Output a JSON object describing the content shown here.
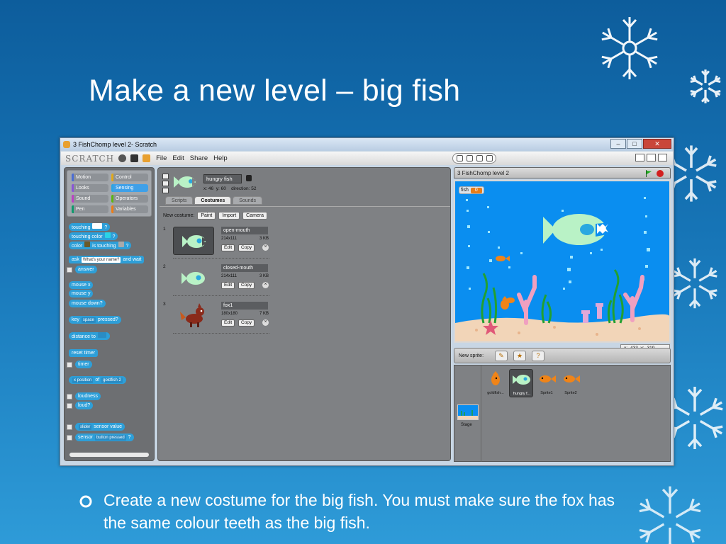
{
  "slide": {
    "title": "Make a new level – big fish",
    "bullet": "Create a new costume for the big fish. You must make sure the fox has the same colour teeth as the big fish."
  },
  "window": {
    "title": "3 FishChomp level 2- Scratch",
    "logo": "SCRATCH",
    "menu": [
      "File",
      "Edit",
      "Share",
      "Help"
    ],
    "controls": [
      "–",
      "□",
      "✕"
    ]
  },
  "palette": {
    "categories": [
      {
        "label": "Motion",
        "color": "#4a6cd4"
      },
      {
        "label": "Control",
        "color": "#e1a91a"
      },
      {
        "label": "Looks",
        "color": "#8a55d7"
      },
      {
        "label": "Sensing",
        "color": "#2ca5e2"
      },
      {
        "label": "Sound",
        "color": "#bb42c3"
      },
      {
        "label": "Operators",
        "color": "#5cb712"
      },
      {
        "label": "Pen",
        "color": "#0e9a6c"
      },
      {
        "label": "Variables",
        "color": "#ee7d16"
      }
    ],
    "selected_category": "Sensing",
    "blocks": {
      "touching": "touching",
      "touching_color": "touching color",
      "color": "color",
      "is_touching": "is touching",
      "q": "?",
      "ask": "ask",
      "ask_input": "What's your name?",
      "and_wait": "and wait",
      "answer": "answer",
      "mouse_x": "mouse x",
      "mouse_y": "mouse y",
      "mouse_down": "mouse down?",
      "key": "key",
      "key_input": "space",
      "pressed": "pressed?",
      "distance_to": "distance to",
      "reset_timer": "reset timer",
      "timer": "timer",
      "x_position": "x position",
      "of": "of",
      "goldfish": "goldfish 2",
      "loudness": "loudness",
      "loud": "loud?",
      "slider": "slider",
      "sensor_value": "sensor value",
      "sensor": "sensor",
      "button_pressed": "button pressed"
    }
  },
  "sprite": {
    "name": "hungry fish",
    "x_label": "x:",
    "x": "46",
    "y_label": "y:",
    "y": "60",
    "direction_label": "direction:",
    "direction": "52"
  },
  "tabs": [
    "Scripts",
    "Costumes",
    "Sounds"
  ],
  "active_tab": "Costumes",
  "costumes": {
    "new_label": "New costume:",
    "paint": "Paint",
    "import": "Import",
    "camera": "Camera",
    "edit": "Edit",
    "copy": "Copy",
    "list": [
      {
        "index": "1",
        "name": "open-mouth",
        "dims": "214x111",
        "size": "3 KB"
      },
      {
        "index": "2",
        "name": "closed-mouth",
        "dims": "214x111",
        "size": "3 KB"
      },
      {
        "index": "3",
        "name": "fox1",
        "dims": "180x180",
        "size": "7 KB"
      }
    ]
  },
  "stage": {
    "title": "3 FishChomp level 2",
    "watcher_label": "fish",
    "watcher_value": "0",
    "mouse_x": "x: -433",
    "mouse_y": "y: -319"
  },
  "sprites_panel": {
    "new_sprite_label": "New sprite:",
    "stage_label": "Stage",
    "sprites": [
      "goldfish...",
      "hungry f...",
      "Sprite1",
      "Sprite2"
    ],
    "selected": "hungry f..."
  },
  "colors": {
    "sensing": "#2e9fd8",
    "stage_water": "#0a8ef0",
    "big_fish": "#b9f2c6",
    "orange_fish": "#f08418"
  }
}
